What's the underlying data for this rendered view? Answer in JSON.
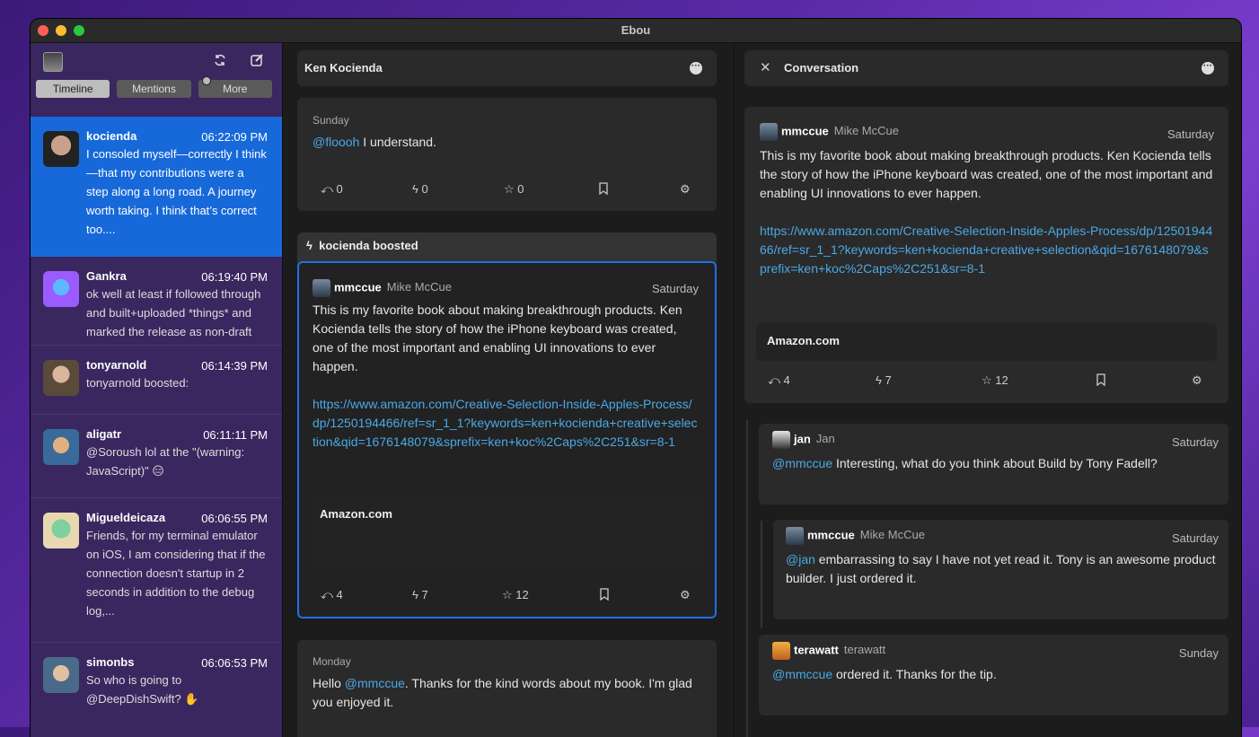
{
  "window": {
    "title": "Ebou"
  },
  "sidebar": {
    "tabs": [
      {
        "label": "Timeline"
      },
      {
        "label": "Mentions"
      },
      {
        "label": "More"
      }
    ],
    "items": [
      {
        "user": "kocienda",
        "time": "06:22:09 PM",
        "text": "I consoled myself—correctly I think—that my contributions were a step along a long road. A journey worth taking. I think that’s correct too....",
        "avatar_color": "#555555"
      },
      {
        "user": "Gankra",
        "time": "06:19:40 PM",
        "text": "ok well at least if followed through and built+uploaded *things* and marked the release as non-draft",
        "avatar_color": "#9b5cff"
      },
      {
        "user": "tonyarnold",
        "time": "06:14:39 PM",
        "text": "tonyarnold boosted:",
        "avatar_color": "#7a6a5a"
      },
      {
        "user": "aligatr",
        "time": "06:11:11 PM",
        "text": "@Soroush lol at the \"(warning: JavaScript)\" 😑",
        "avatar_color": "#6a5040"
      },
      {
        "user": "Migueldeicaza",
        "time": "06:06:55 PM",
        "text": "Friends, for my terminal emulator on iOS, I am considering that if the connection doesn't startup in 2 seconds in addition to the debug log,...",
        "avatar_color": "#5fb0a0"
      },
      {
        "user": "simonbs",
        "time": "06:06:53 PM",
        "text": "So who is going to @DeepDishSwift? ✋",
        "avatar_color": "#8a7a6a"
      }
    ]
  },
  "column1": {
    "title": "Ken Kocienda",
    "post1": {
      "date": "Sunday",
      "mention": "@floooh",
      "text": " I understand.",
      "replies": "0",
      "boosts": "0",
      "stars": "0"
    },
    "boost_header": "kocienda boosted",
    "post2": {
      "username": "mmccue",
      "display": "Mike McCue",
      "date": "Saturday",
      "text": "This is my favorite book about making breakthrough products. Ken Kocienda tells the story of how the iPhone keyboard was created, one of the most important and enabling UI innovations to ever happen.",
      "link": "https://www.amazon.com/Creative-Selection-Inside-Apples-Process/dp/1250194466/ref=sr_1_1?keywords=ken+kocienda+creative+selection&qid=1676148079&sprefix=ken+koc%2Caps%2C251&sr=8-1",
      "preview": "Amazon.com",
      "replies": "4",
      "boosts": "7",
      "stars": "12"
    },
    "post3": {
      "date": "Monday",
      "pre": "Hello ",
      "mention": "@mmccue",
      "text": ". Thanks for the kind words about my book. I'm glad you enjoyed it."
    }
  },
  "column2": {
    "title": "Conversation",
    "main": {
      "username": "mmccue",
      "display": "Mike McCue",
      "date": "Saturday",
      "text": "This is my favorite book about making breakthrough products. Ken Kocienda tells the story of how the iPhone keyboard was created, one of the most important and enabling UI innovations to ever happen.",
      "link": "https://www.amazon.com/Creative-Selection-Inside-Apples-Process/dp/1250194466/ref=sr_1_1?keywords=ken+kocienda+creative+selection&qid=1676148079&sprefix=ken+koc%2Caps%2C251&sr=8-1",
      "preview": "Amazon.com",
      "replies": "4",
      "boosts": "7",
      "stars": "12"
    },
    "reply1": {
      "username": "jan",
      "display": "Jan",
      "date": "Saturday",
      "mention": "@mmccue",
      "text": " Interesting, what do you think about Build by Tony Fadell?"
    },
    "reply2": {
      "username": "mmccue",
      "display": "Mike McCue",
      "date": "Saturday",
      "mention": "@jan",
      "text": " embarrassing to say I have not yet read it. Tony is an awesome product builder. I just ordered it."
    },
    "reply3": {
      "username": "terawatt",
      "display": "terawatt",
      "date": "Sunday",
      "mention": "@mmccue",
      "text": " ordered it. Thanks for the tip."
    }
  }
}
